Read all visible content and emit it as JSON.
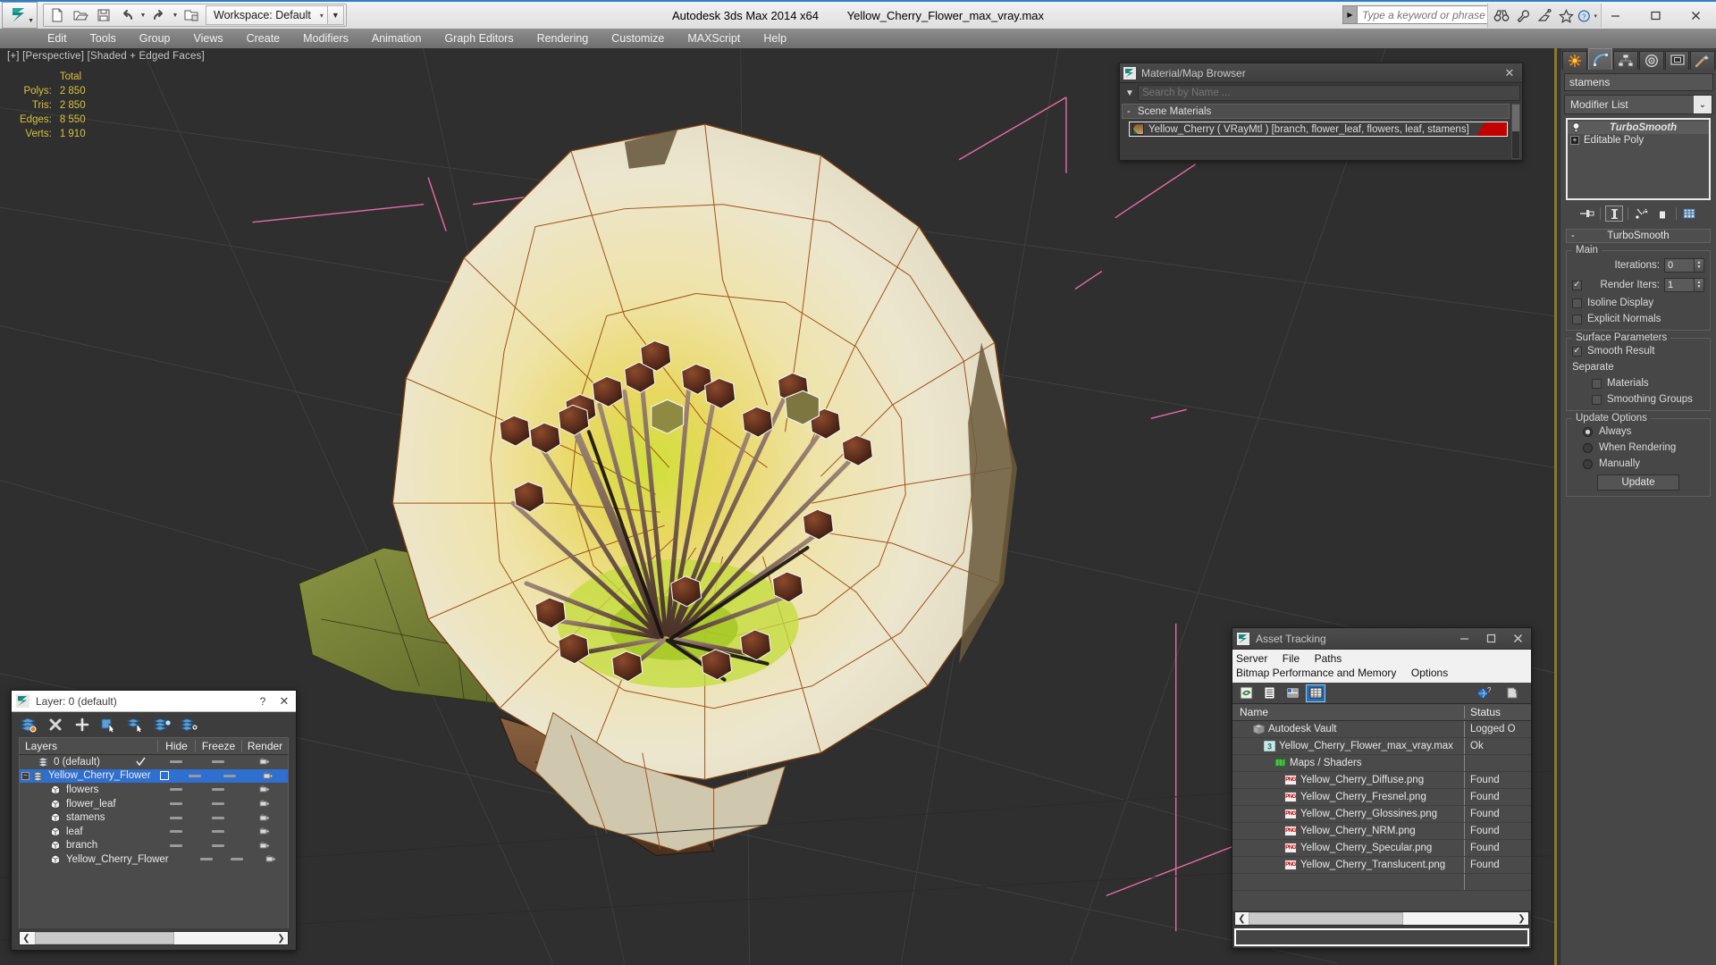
{
  "titlebar": {
    "app_title": "Autodesk 3ds Max  2014 x64",
    "file_name": "Yellow_Cherry_Flower_max_vray.max",
    "workspace_label": "Workspace: Default",
    "search_placeholder": "Type a keyword or phrase",
    "quick_access": [
      {
        "name": "new-file-icon",
        "label": "New"
      },
      {
        "name": "open-file-icon",
        "label": "Open"
      },
      {
        "name": "save-file-icon",
        "label": "Save"
      },
      {
        "name": "undo-icon",
        "label": "Undo"
      },
      {
        "name": "redo-icon",
        "label": "Redo"
      },
      {
        "name": "set-project-folder-icon",
        "label": "Set Project Folder"
      }
    ],
    "help_icons": [
      {
        "name": "binoculars-icon",
        "label": "Search"
      },
      {
        "name": "wrench-icon",
        "label": "Tools"
      },
      {
        "name": "satellite-dish-icon",
        "label": "Subscription"
      },
      {
        "name": "star-icon",
        "label": "Favorites"
      },
      {
        "name": "help-question-icon",
        "label": "Help"
      }
    ],
    "window_controls": [
      {
        "name": "minimize-button",
        "label": "Minimize"
      },
      {
        "name": "maximize-button",
        "label": "Maximize"
      },
      {
        "name": "close-button",
        "label": "Close"
      }
    ]
  },
  "menubar": {
    "items": [
      "Edit",
      "Tools",
      "Group",
      "Views",
      "Create",
      "Modifiers",
      "Animation",
      "Graph Editors",
      "Rendering",
      "Customize",
      "MAXScript",
      "Help"
    ]
  },
  "viewport": {
    "label": "[+] [Perspective] [Shaded + Edged Faces]",
    "stats_header": "Total",
    "stats": [
      {
        "label": "Polys:",
        "value": "2 850"
      },
      {
        "label": "Tris:",
        "value": "2 850"
      },
      {
        "label": "Edges:",
        "value": "8 550"
      },
      {
        "label": "Verts:",
        "value": "1 910"
      }
    ],
    "colors": {
      "background": "#2f2f2f",
      "grid": "#3c3c3c",
      "wire_orange": "#9c4a10",
      "petal": "#e8e0c4",
      "petal_yellow": "#e5cf74",
      "center_green": "#b6d33a",
      "stamen_head": "#6b3520",
      "leaf_green": "#6f7a32",
      "branch_brown": "#6a4a32",
      "pink_helper": "#e56fa8"
    }
  },
  "material_browser": {
    "title": "Material/Map Browser",
    "search_placeholder": "Search by Name ...",
    "group_label": "Scene Materials",
    "group_collapse": "-",
    "material_name": "Yellow_Cherry  ( VRayMtl )  [branch, flower_leaf, flowers, leaf, stamens]",
    "close_label": "✕"
  },
  "asset_tracking": {
    "title": "Asset Tracking",
    "menu": [
      "Server",
      "File",
      "Paths",
      "Bitmap Performance and Memory",
      "Options"
    ],
    "toolbar": [
      {
        "name": "refresh-icon",
        "active": false
      },
      {
        "name": "list-view-icon",
        "active": false
      },
      {
        "name": "detail-view-icon",
        "active": false
      },
      {
        "name": "grid-view-icon",
        "active": true
      }
    ],
    "toolbar_right": [
      {
        "name": "help-globe-icon"
      },
      {
        "name": "help-page-icon"
      }
    ],
    "columns": {
      "name": "Name",
      "status": "Status"
    },
    "rows": [
      {
        "icon": "vault-icon",
        "indent": 1,
        "name": "Autodesk Vault",
        "status": "Logged O"
      },
      {
        "icon": "max-file-icon",
        "indent": 2,
        "name": "Yellow_Cherry_Flower_max_vray.max",
        "status": "Ok"
      },
      {
        "icon": "maps-shaders-icon",
        "indent": 3,
        "name": "Maps / Shaders",
        "status": ""
      },
      {
        "icon": "png-icon",
        "indent": 4,
        "name": "Yellow_Cherry_Diffuse.png",
        "status": "Found"
      },
      {
        "icon": "png-icon",
        "indent": 4,
        "name": "Yellow_Cherry_Fresnel.png",
        "status": "Found"
      },
      {
        "icon": "png-icon",
        "indent": 4,
        "name": "Yellow_Cherry_Glossines.png",
        "status": "Found"
      },
      {
        "icon": "png-icon",
        "indent": 4,
        "name": "Yellow_Cherry_NRM.png",
        "status": "Found"
      },
      {
        "icon": "png-icon",
        "indent": 4,
        "name": "Yellow_Cherry_Specular.png",
        "status": "Found"
      },
      {
        "icon": "png-icon",
        "indent": 4,
        "name": "Yellow_Cherry_Translucent.png",
        "status": "Found"
      }
    ],
    "window_controls": [
      {
        "name": "minimize-button",
        "label": "Minimize"
      },
      {
        "name": "maximize-button",
        "label": "Maximize"
      },
      {
        "name": "close-button",
        "label": "Close"
      }
    ]
  },
  "layer_manager": {
    "title": "Layer: 0 (default)",
    "help_label": "?",
    "close_label": "✕",
    "toolbar": [
      {
        "name": "create-new-layer-icon"
      },
      {
        "name": "delete-layer-icon"
      },
      {
        "name": "add-selection-to-layer-icon"
      },
      {
        "name": "select-objects-in-layer-icon"
      },
      {
        "name": "select-highlighted-objects-icon"
      },
      {
        "name": "highlight-selected-objects-layer-icon"
      },
      {
        "name": "layer-properties-icon"
      }
    ],
    "columns": [
      "Layers",
      "Hide",
      "Freeze",
      "Render"
    ],
    "rows": [
      {
        "name": "0 (default)",
        "type": "layer",
        "indent": 1,
        "expandable": false,
        "selected": false,
        "checkmark": true,
        "checkbox": false
      },
      {
        "name": "Yellow_Cherry_Flower",
        "type": "layer",
        "indent": 0,
        "expandable": true,
        "selected": true,
        "checkmark": false,
        "checkbox": true
      },
      {
        "name": "flowers",
        "type": "object",
        "indent": 2,
        "expandable": false,
        "selected": false,
        "checkmark": false,
        "checkbox": false
      },
      {
        "name": "flower_leaf",
        "type": "object",
        "indent": 2,
        "expandable": false,
        "selected": false,
        "checkmark": false,
        "checkbox": false
      },
      {
        "name": "stamens",
        "type": "object",
        "indent": 2,
        "expandable": false,
        "selected": false,
        "checkmark": false,
        "checkbox": false
      },
      {
        "name": "leaf",
        "type": "object",
        "indent": 2,
        "expandable": false,
        "selected": false,
        "checkmark": false,
        "checkbox": false
      },
      {
        "name": "branch",
        "type": "object",
        "indent": 2,
        "expandable": false,
        "selected": false,
        "checkmark": false,
        "checkbox": false
      },
      {
        "name": "Yellow_Cherry_Flower",
        "type": "object",
        "indent": 2,
        "expandable": false,
        "selected": false,
        "checkmark": false,
        "checkbox": false
      }
    ]
  },
  "command_panel": {
    "tabs": [
      {
        "name": "create-tab",
        "icon": "star-burst-icon",
        "active": false
      },
      {
        "name": "modify-tab",
        "icon": "curve-icon",
        "active": true
      },
      {
        "name": "hierarchy-tab",
        "icon": "hierarchy-icon",
        "active": false
      },
      {
        "name": "motion-tab",
        "icon": "motion-wheel-icon",
        "active": false
      },
      {
        "name": "display-tab",
        "icon": "display-monitor-icon",
        "active": false
      },
      {
        "name": "utilities-tab",
        "icon": "hammer-icon",
        "active": false
      }
    ],
    "object_name": "stamens",
    "object_color": "#c2861f",
    "modifier_list_label": "Modifier List",
    "stack": [
      {
        "name": "TurboSmooth",
        "active": true,
        "italic": true
      },
      {
        "name": "Editable Poly",
        "active": false,
        "italic": false
      }
    ],
    "stack_tools": [
      {
        "name": "pin-stack-icon"
      },
      {
        "name": "show-end-result-icon",
        "framed": true
      },
      {
        "name": "make-unique-icon"
      },
      {
        "name": "remove-modifier-icon"
      },
      {
        "name": "configure-modifier-sets-icon"
      }
    ],
    "rollout": {
      "title": "TurboSmooth",
      "collapse": "-",
      "groups": [
        {
          "title": "Main",
          "iterations_label": "Iterations:",
          "iterations_value": "0",
          "render_iters_label": "Render Iters:",
          "render_iters_value": "1",
          "render_iters_checked": true,
          "isoline_label": "Isoline Display",
          "isoline_checked": false,
          "explicit_label": "Explicit Normals",
          "explicit_checked": false
        },
        {
          "title": "Surface Parameters",
          "smooth_result_label": "Smooth Result",
          "smooth_result_checked": true,
          "separate_label": "Separate",
          "materials_label": "Materials",
          "materials_checked": false,
          "smoothing_groups_label": "Smoothing Groups",
          "smoothing_groups_checked": false
        },
        {
          "title": "Update Options",
          "options": [
            {
              "label": "Always",
              "selected": true
            },
            {
              "label": "When Rendering",
              "selected": false
            },
            {
              "label": "Manually",
              "selected": false
            }
          ],
          "update_button": "Update"
        }
      ]
    }
  }
}
